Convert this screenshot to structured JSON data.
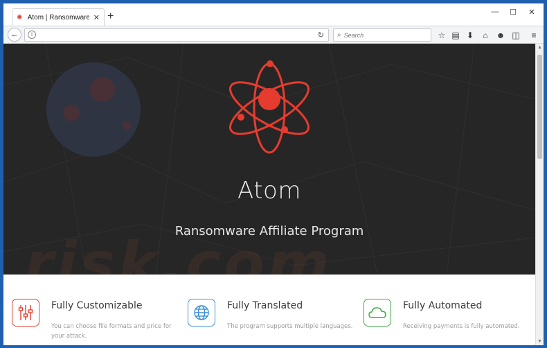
{
  "browser": {
    "tab_title": "Atom | Ransomware Affili...",
    "tab_favicon": "atom-icon",
    "tab_close": "✕",
    "new_tab": "+",
    "window_controls": {
      "minimize": "—",
      "maximize": "☐",
      "close": "✕"
    },
    "back_icon": "←",
    "info_icon": "i",
    "reload_icon": "↻",
    "search_placeholder": "Search",
    "search_icon": "⌕",
    "toolbar_icons": [
      "☆",
      "▤",
      "⬇",
      "⌂",
      "☻",
      "◫",
      "≡"
    ]
  },
  "page": {
    "title": "Atom",
    "subtitle": "Ransomware Affiliate Program",
    "watermark": "risk.com",
    "accent_color": "#e63c2f",
    "features": [
      {
        "icon": "sliders-icon",
        "title": "Fully Customizable",
        "description": "You can choose file formats and price for your attack.",
        "color": "#e63c2f"
      },
      {
        "icon": "globe-icon",
        "title": "Fully Translated",
        "description": "The program supports multiple languages.",
        "color": "#3a8fd8"
      },
      {
        "icon": "cloud-icon",
        "title": "Fully Automated",
        "description": "Receiving payments is fully automated.",
        "color": "#3aa845"
      }
    ]
  },
  "scrollbar": {
    "up": "▲",
    "down": "▼"
  }
}
